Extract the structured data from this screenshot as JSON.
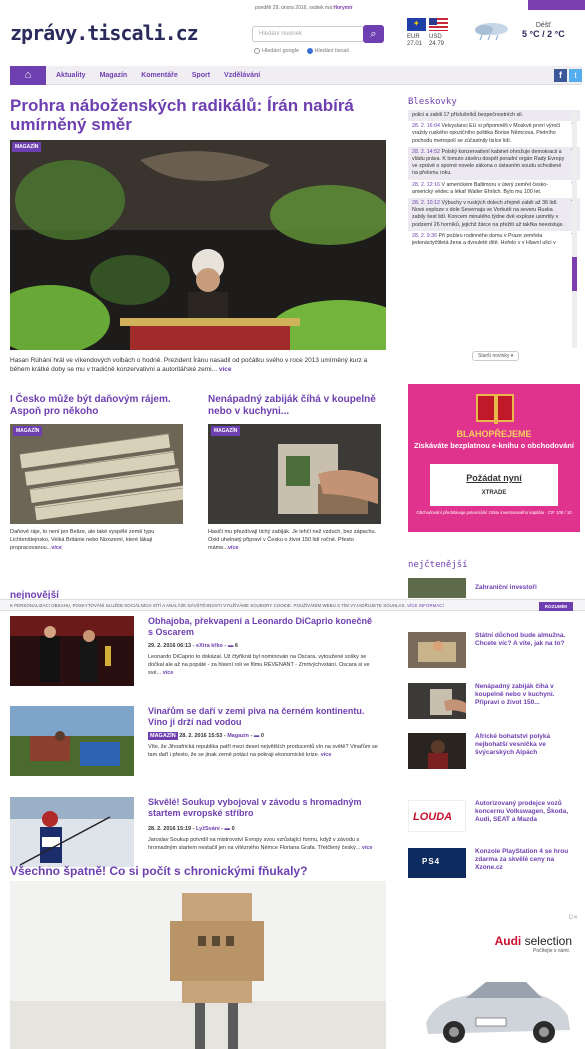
{
  "header": {
    "logo": "zprávy.tiscali.cz",
    "notice": "pondělí 29. února 2016, svátek má",
    "notice_name": "Horymír",
    "search_placeholder": "Hledání novinek",
    "search_options": [
      "Hledání google",
      "Hledání tiscali"
    ],
    "currency": {
      "labels": [
        "EUR",
        "USD"
      ],
      "values": [
        "27.01",
        "24.79"
      ]
    },
    "weather": {
      "label": "Déšť",
      "temp": "5 °C / 2 °C"
    }
  },
  "nav": {
    "home_icon": "home-icon",
    "items": [
      "Aktuality",
      "Magazín",
      "Komentáře",
      "Sport",
      "Vzdělávání"
    ],
    "social": {
      "fb": "f",
      "tw": "t"
    }
  },
  "main": {
    "headline": "Prohra náboženských radikálů: Írán nabírá umírněný směr",
    "label": "MAGAZÍN",
    "caption": "Hasan Rúhání hrál ve víkendových volbách o hodně. Prezident Íránu nasadil od počátku svého v roce 2013 umírněný kurz a během krátké doby se mu v tradičně konzervativní a autoritářské zemi...",
    "vice": "více",
    "sub": [
      {
        "title": "I Česko může být daňovým rájem. Aspoň pro někoho",
        "label": "MAGAZÍN",
        "text": "Daňové ráje, to není jen Belize, ale také vyspělé země typu Lichtenštejnsko, Velká Británie nebo Nizozemí, které lákají propracovanou...",
        "vice": "více"
      },
      {
        "title": "Nenápadný zabiják číhá v koupelně nebo v kuchyni...",
        "label": "MAGAZÍN",
        "text": "Hasiči mu přezdívají tichý zabiják. Je lehčí než vzduch, bez zápachu. Oxid uhelnatý připraví v Česku o život 150 lidí ročně. Přesto máme...",
        "vice": "více"
      }
    ],
    "partial_section": "nejnovější"
  },
  "cookie": {
    "text": "K PERSONALIZACI OBSAHU, POSKYTOVÁNÍ SLUŽEB SOCIÁLNÍCH SÍTÍ A ANALÝZE NÁVŠTĚVNOSTI VYUŽÍVÁME SOUBORY COOKIE. POUŽÍVÁNÍM WEBU S TÍM VYJADŘUJETE SOUHLAS.",
    "more": "VÍCE INFORMACÍ",
    "ok": "ROZUMÍM"
  },
  "articles": [
    {
      "title": "Obhajoba, překvapení a Leonardo DiCaprio konečně s Oscarem",
      "date": "29. 2. 2016 06:13",
      "section": "eXtra křko",
      "comments": "6",
      "text": "Leonardo DiCaprio to dokázal. Už čtyřikrát byl nominován na Oscara, vytoužené sošky se dočkal ale až na popáté - za hlavní roli ve filmu REVENANT - Zmrtvýchvstání. Oscara si ve své...",
      "vice": "více"
    },
    {
      "title": "Vinařům se daří v zemi piva na černém kontinentu. Víno ji drží nad vodou",
      "tag": "MAGAZÍN",
      "date": "28. 2. 2016 15:53",
      "section": "Magazín",
      "comments": "0",
      "text": "Víte, že Jihoafrická republika patří mezi deset největších producentů vín na světě? Vinařům se tam daří i přesto, že se jinak země potácí na pokraji ekonomické krize.",
      "vice": "více"
    },
    {
      "title": "Skvělé! Soukup vybojoval v závodu s hromadným startem evropské stříbro",
      "date": "28. 2. 2016 15:19",
      "section": "LyžSvání",
      "comments": "0",
      "text": "Jaroslav Soukup potvrdil na mistrovství Evropy svou vzrůstající formu, když v závodu s hromadným startem nestačil jen na vítězného Němce Floriana Grafa. Třetčlený český...",
      "vice": "více"
    }
  ],
  "bottom": {
    "title": "Všechno špatně! Co si počít s chronickými fňukaly?"
  },
  "bleskovky": {
    "title": "Bleskovky",
    "items": [
      {
        "time": "",
        "text": "polici a zabili 17 příslušníků bezpečnostních sil.",
        "link": ""
      },
      {
        "time": "28. 2. 16:04",
        "text": "Velvyslanci EU si připomněli v Moskvě první výročí vraždy ruského opozičního politika Borise Němcova. Pietního pochodu metropolí se zúčastnily tisíce lidí.",
        "link": ""
      },
      {
        "time": "28. 2. 14:52",
        "text": "Polský konzervativní kabinet ohrožuje demokracii a vládu práva. K tomuto závěru dospěl poradní orgán Rady Evropy ve zprávě o sporné novele zákona o ústavním soudu schválené na přelomu roku.",
        "link": ""
      },
      {
        "time": "28. 2. 12:16",
        "text": "V americkém Baltimoru v úterý zemřel česko-americký vědec a lékař Walter Ehrlich. Bylo mu 100 let.",
        "link": ""
      },
      {
        "time": "28. 2. 10:12",
        "text": "Výbuchy v ruských dolech zřejmě zabili až 36 lidí. Nové exploze v dole Severnaja ve Vorkutě na severu Ruska zabily šest lidí. Koncem minulého týdne dvě exploze usmrtily v podzemí 26 horníků, jejichž žárce na přežití už takřka neexistuje.",
        "link": ""
      },
      {
        "time": "28. 2. 9:36",
        "text": "Při požáru rodinného domu v Praze zemřela jedenáctyčtiletá žena a dvouleté dítě. Hořelo v v Hlavní ulici v",
        "link": ""
      }
    ],
    "more": "Starší novinky ▾"
  },
  "ad": {
    "h1": "BLAHOPŘEJEME",
    "h2": "Získáváte bezplatnou e-knihu o obchodování",
    "button": "Požádat nyní",
    "logo": "XTRADE",
    "foot": "Obchodování představuje potenciální ztrátu investovaného kapitálu · CIF 108 / 10"
  },
  "nejctenejsi": {
    "title": "nejčtenější",
    "items": [
      "Zahraniční investoři",
      "Státní důchod bude almužna. Chcete víc? A víte, jak na to?",
      "Nenápadný zabiják číhá v koupelně nebo v kuchyni. Připraví o život 150...",
      "Africké bohatství polyká nejbohatší vesnička ve švýcarských Alpách"
    ]
  },
  "promo": [
    {
      "logo": "LOUDA",
      "text": "Autorizovaný prodejce vozů koncernu Volkswagen, Škoda, Audi, SEAT a Mazda"
    },
    {
      "logo": "PS4",
      "text": "Konzole PlayStation 4 se hrou zdarma za skvělé ceny na Xzone.cz"
    }
  ],
  "audi": {
    "name": "Audi",
    "name2": "selection",
    "slogan": "Počítejte s námi."
  },
  "colors": {
    "accent": "#6e3fb0",
    "nav_bg": "#f0eef3",
    "ad_bg": "#e0338e"
  }
}
